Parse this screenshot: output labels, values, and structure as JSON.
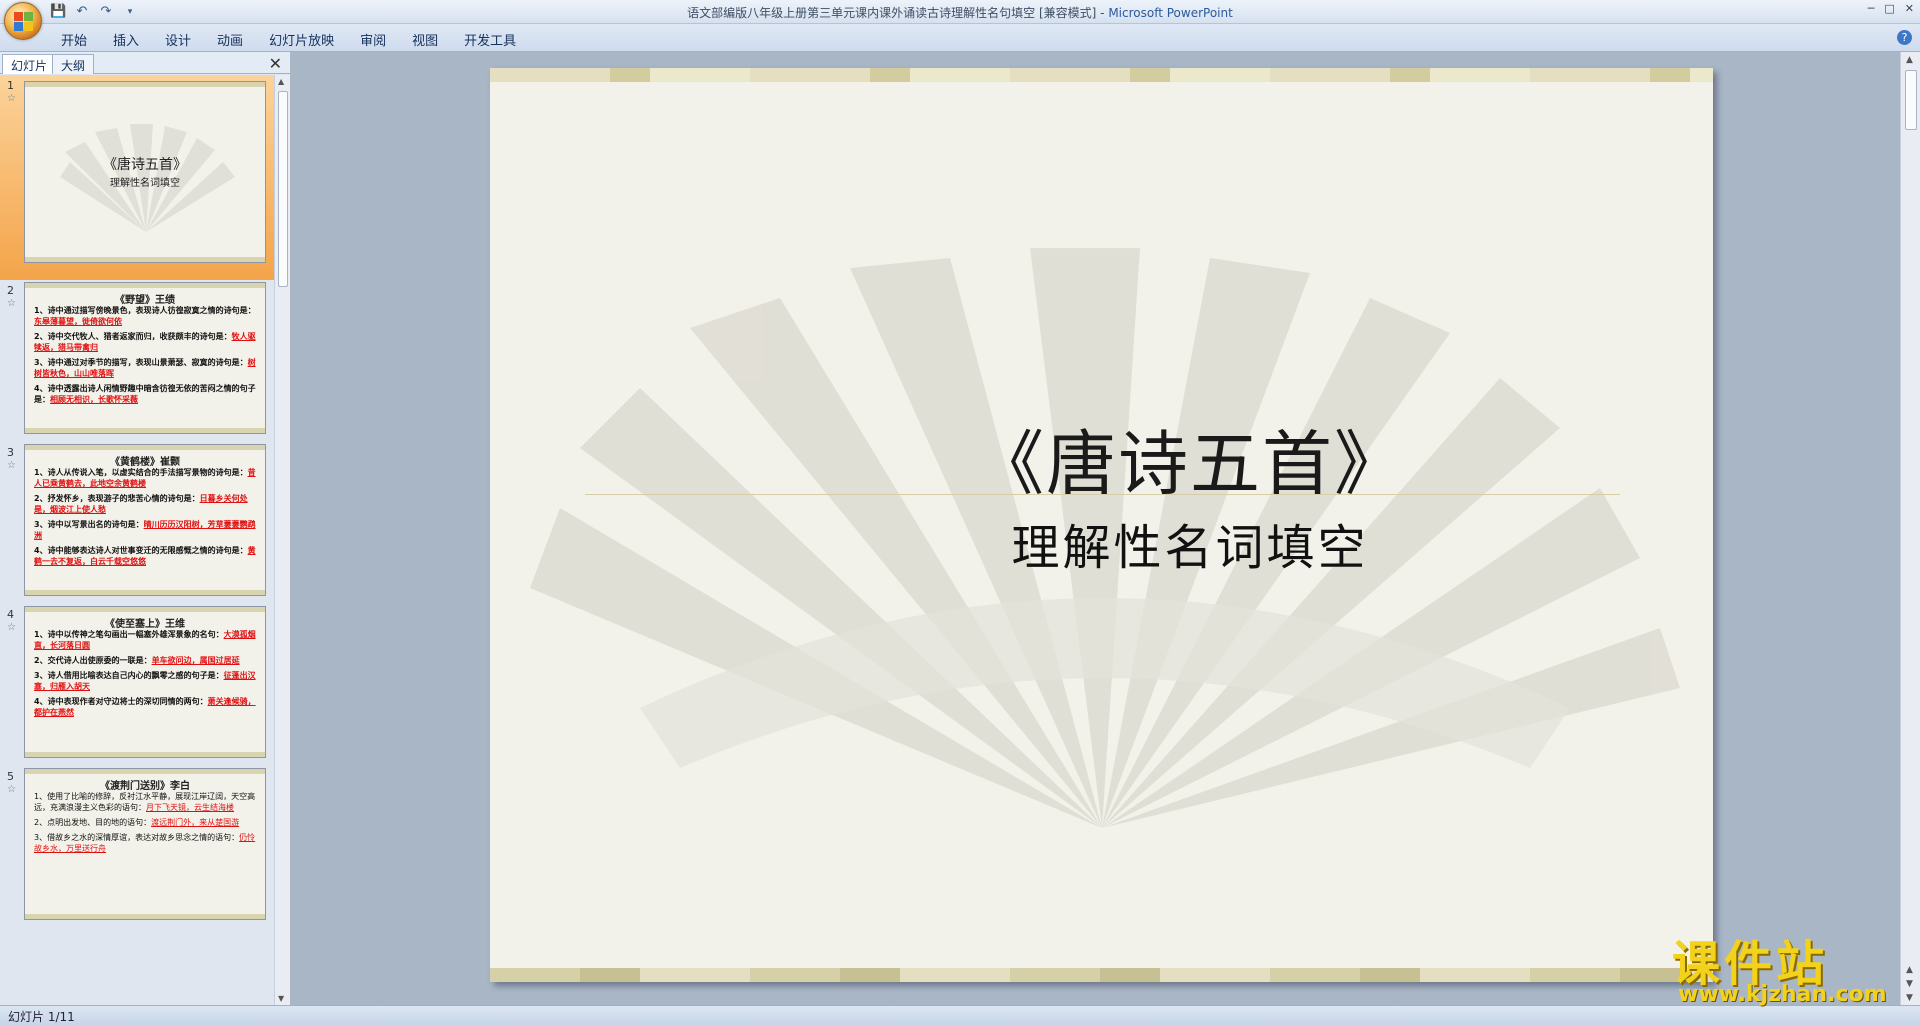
{
  "window": {
    "title": "语文部编版八年级上册第三单元课内课外诵读古诗理解性名句填空 [兼容模式] - ",
    "app_name": "Microsoft PowerPoint"
  },
  "menu": [
    "开始",
    "插入",
    "设计",
    "动画",
    "幻灯片放映",
    "审阅",
    "视图",
    "开发工具"
  ],
  "pane_tabs": {
    "slides": "幻灯片",
    "outline": "大纲"
  },
  "thumbnails": [
    {
      "num": "1",
      "title": "《唐诗五首》",
      "subtitle": "理解性名词填空"
    },
    {
      "num": "2",
      "title": "《野望》王绩",
      "lines": [
        {
          "text": "1、诗中通过描写傍晚景色，表现诗人彷徨寂寞之情的诗句是：",
          "answer": "东皋薄暮望，徙倚欲何依"
        },
        {
          "text": "2、诗中交代牧人、猎者返家而归，收获颇丰的诗句是：",
          "answer": "牧人驱犊返，猎马带禽归"
        },
        {
          "text": "3、诗中通过对季节的描写，表现山景萧瑟、寂寞的诗句是：",
          "answer": "树树皆秋色，山山唯落晖"
        },
        {
          "text": "4、诗中透露出诗人闲情野趣中暗含彷徨无依的苦闷之情的句子是：",
          "answer": "相顾无相识，长歌怀采薇"
        }
      ]
    },
    {
      "num": "3",
      "title": "《黄鹤楼》崔颢",
      "lines": [
        {
          "text": "1、诗人从传说入笔，以虚实结合的手法描写景物的诗句是：",
          "answer": "昔人已乘黄鹤去，此地空余黄鹤楼"
        },
        {
          "text": "2、抒发怀乡，表现游子的悲苦心情的诗句是：",
          "answer": "日暮乡关何处是，烟波江上使人愁"
        },
        {
          "text": "3、诗中以写景出名的诗句是：",
          "answer": "晴川历历汉阳树，芳草萋萋鹦鹉洲"
        },
        {
          "text": "4、诗中能够表达诗人对世事变迁的无限感慨之情的诗句是：",
          "answer": "黄鹤一去不复返，白云千载空悠悠"
        }
      ]
    },
    {
      "num": "4",
      "title": "《使至塞上》王维",
      "lines": [
        {
          "text": "1、诗中以传神之笔勾画出一幅塞外雄浑景象的名句：",
          "answer": "大漠孤烟直，长河落日圆"
        },
        {
          "text": "2、交代诗人出使原委的一联是：",
          "answer": "单车欲问边，属国过居延"
        },
        {
          "text": "3、诗人借用比喻表达自己内心的飘零之感的句子是：",
          "answer": "征蓬出汉塞，归雁入胡天"
        },
        {
          "text": "4、诗中表现作者对守边将士的深切同情的两句：",
          "answer": "萧关逢候骑，都护在燕然"
        }
      ]
    },
    {
      "num": "5",
      "title": "《渡荆门送别》李白",
      "lines": [
        {
          "text": "1、使用了比喻的修辞，反衬江水平静，展现江岸辽阔，天空高远，充满浪漫主义色彩的语句：",
          "answer": "月下飞天镜，云生结海楼"
        },
        {
          "text": "2、点明出发地、目的地的语句：",
          "answer": "渡远荆门外，来从楚国游"
        },
        {
          "text": "3、借故乡之水的深情厚谊，表达对故乡思念之情的语句：",
          "answer": "仍怜故乡水，万里送行舟"
        }
      ]
    }
  ],
  "slide": {
    "title": "《唐诗五首》",
    "subtitle": "理解性名词填空"
  },
  "status": {
    "slide_count": "幻灯片 1/11"
  },
  "watermark": {
    "name": "课件站",
    "url": "www.kjzhan.com"
  }
}
